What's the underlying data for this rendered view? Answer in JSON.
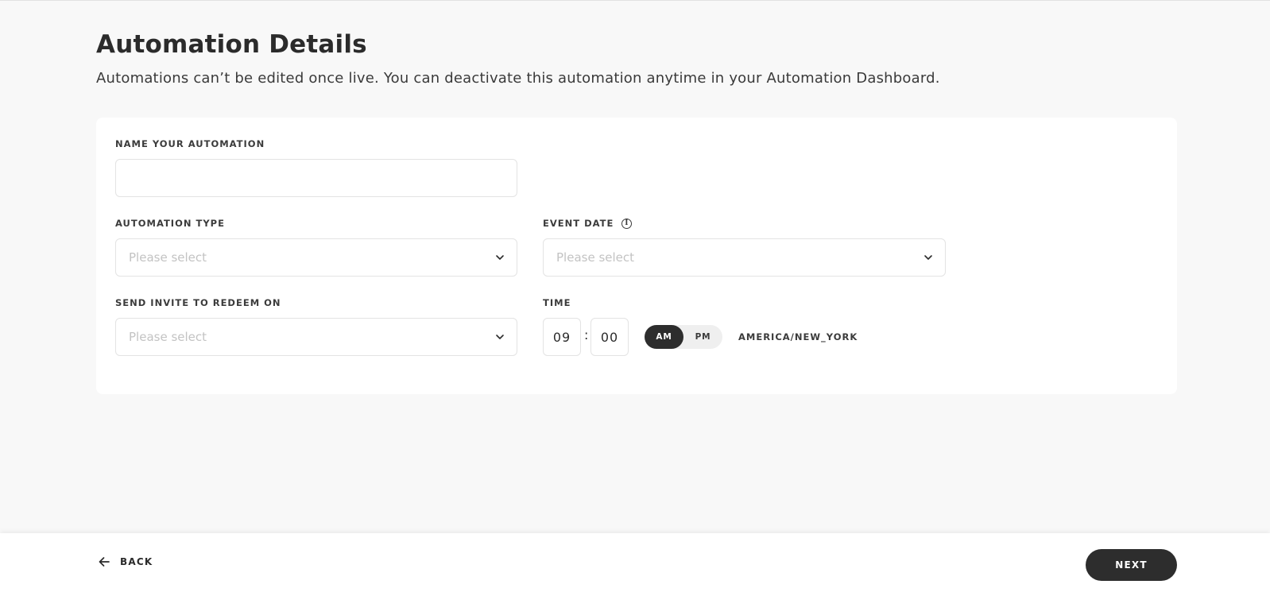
{
  "header": {
    "title": "Automation Details",
    "subtitle": "Automations can’t be edited once live. You can deactivate this automation anytime in your Automation Dashboard."
  },
  "form": {
    "name": {
      "label": "NAME YOUR AUTOMATION",
      "value": "",
      "placeholder": ""
    },
    "automation_type": {
      "label": "AUTOMATION TYPE",
      "placeholder": "Please select"
    },
    "event_date": {
      "label": "EVENT DATE",
      "info_icon": "info-icon",
      "info_glyph": "i",
      "placeholder": "Please select"
    },
    "send_invite": {
      "label": "SEND INVITE TO REDEEM ON",
      "placeholder": "Please select"
    },
    "time": {
      "label": "TIME",
      "hour": "09",
      "separator": ":",
      "minute": "00",
      "am_label": "AM",
      "pm_label": "PM",
      "selected_period": "AM",
      "timezone": "AMERICA/NEW_YORK"
    }
  },
  "footer": {
    "back_label": "BACK",
    "next_label": "NEXT"
  },
  "colors": {
    "page_background": "#f8f8f8",
    "card_background": "#ffffff",
    "primary_dark": "#2d2d2d",
    "placeholder": "#c3c3c3",
    "border": "#e3e3e3"
  }
}
